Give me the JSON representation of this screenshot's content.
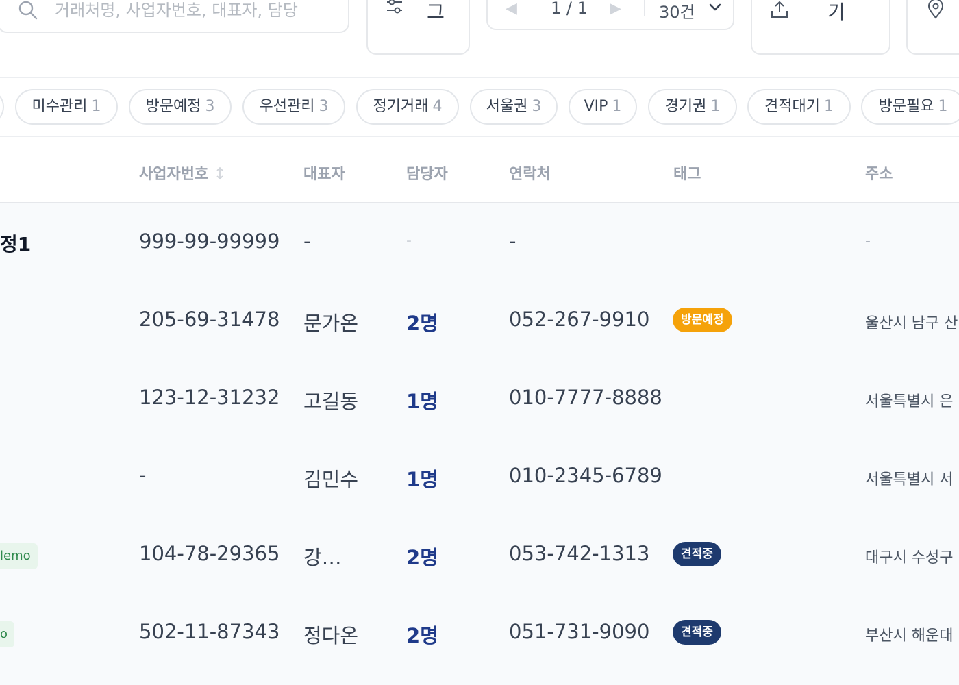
{
  "toolbar": {
    "search_placeholder": "거래처명, 사업자번호, 대표자, 담당",
    "filter_label": "필\n그",
    "pager": {
      "prev": "◀",
      "page": "1 / 1",
      "next": "▶",
      "page_size": "30건"
    },
    "export_label": "내\n기",
    "icons": {
      "search": "search-icon",
      "filter": "filter-icon",
      "export": "upload-icon",
      "map": "map-pin-icon",
      "dropdown": "chevron-down-icon"
    }
  },
  "chips": [
    {
      "label": "미수관리",
      "count": "1"
    },
    {
      "label": "방문예정",
      "count": "3"
    },
    {
      "label": "우선관리",
      "count": "3"
    },
    {
      "label": "정기거래",
      "count": "4"
    },
    {
      "label": "서울권",
      "count": "3"
    },
    {
      "label": "VIP",
      "count": "1"
    },
    {
      "label": "경기권",
      "count": "1"
    },
    {
      "label": "견적대기",
      "count": "1"
    },
    {
      "label": "방문필요",
      "count": "1"
    }
  ],
  "table": {
    "headers": {
      "biz_no": "사업자번호",
      "ceo": "대표자",
      "manager": "담당자",
      "contact": "연락처",
      "tag": "태그",
      "address": "주소"
    },
    "rows": [
      {
        "name": "정1",
        "chip": "",
        "biz_no": "999-99-99999",
        "ceo": "-",
        "manager": "-",
        "contact": "-",
        "tag": "",
        "address": "-"
      },
      {
        "name": "",
        "chip": "",
        "biz_no": "205-69-31478",
        "ceo": "문가온",
        "manager": "2명",
        "contact": "052-267-9910",
        "tag": "방문예정",
        "address": "울산시 남구 산"
      },
      {
        "name": "",
        "chip": "",
        "biz_no": "123-12-31232",
        "ceo": "고길동",
        "manager": "1명",
        "contact": "010-7777-8888",
        "tag": "",
        "address": "서울특별시 은"
      },
      {
        "name": "",
        "chip": "",
        "biz_no": "-",
        "ceo": "김민수",
        "manager": "1명",
        "contact": "010-2345-6789",
        "tag": "",
        "address": "서울특별시 서"
      },
      {
        "name": "",
        "chip": "lemo",
        "biz_no": "104-78-29365",
        "ceo": "강…",
        "manager": "2명",
        "contact": "053-742-1313",
        "tag": "견적중",
        "address": "대구시 수성구"
      },
      {
        "name": "",
        "chip": "o",
        "biz_no": "502-11-87343",
        "ceo": "정다온",
        "manager": "2명",
        "contact": "051-731-9090",
        "tag": "견적중",
        "address": "부산시 해운대"
      }
    ]
  },
  "colors": {
    "accent": "#1f3a8a",
    "tag_visit": "#f5a20a",
    "tag_quote": "#1e3a6e",
    "chip_green": "#2f8a4c"
  }
}
